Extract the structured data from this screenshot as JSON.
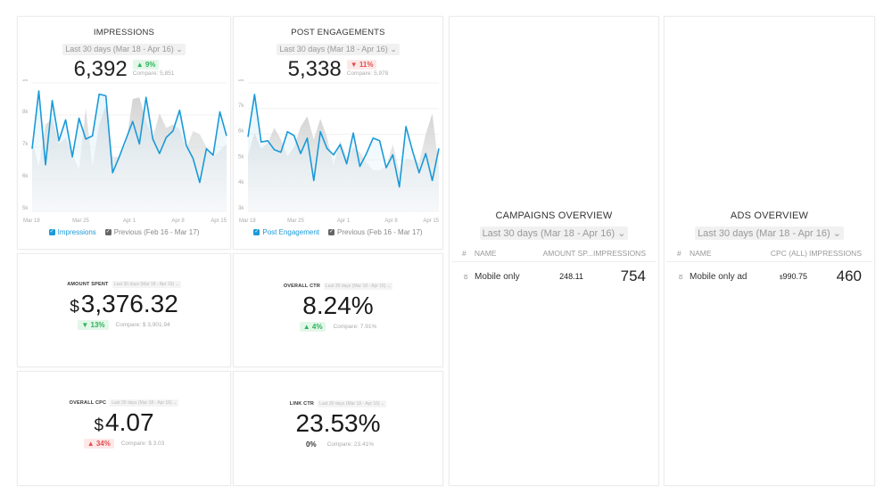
{
  "date_range": "Last 30 days (Mar 18 - Apr 16)",
  "date_range_chevron": "⌄",
  "colors": {
    "primary_line": "#1a9ad8",
    "previous_area": "#d9d9d9",
    "positive": "#2cb35a",
    "negative": "#e05050"
  },
  "impressions": {
    "title": "IMPRESSIONS",
    "value": "6,392",
    "delta": "▲ 9%",
    "compare": "Compare: 5,851",
    "legend_current": "Impressions",
    "legend_previous": "Previous (Feb 16 - Mar 17)"
  },
  "post_engagements": {
    "title": "POST ENGAGEMENTS",
    "value": "5,338",
    "delta": "▼ 11%",
    "compare": "Compare: 5,978",
    "legend_current": "Post Engagement",
    "legend_previous": "Previous (Feb 16 - Mar 17)"
  },
  "amount_spent": {
    "title": "AMOUNT SPENT",
    "range": "Last 30 days (Mar 18 - Apr 16)",
    "currency": "$",
    "value": "3,376.32",
    "delta": "▼ 13%",
    "compare": "Compare: $ 3,901.94"
  },
  "overall_ctr": {
    "title": "OVERALL CTR",
    "range": "Last 30 days (Mar 18 - Apr 16)",
    "value": "8.24%",
    "delta": "▲ 4%",
    "compare": "Compare: 7.91%"
  },
  "overall_cpc": {
    "title": "OVERALL CPC",
    "range": "Last 30 days (Mar 18 - Apr 16)",
    "currency": "$",
    "value": "4.07",
    "delta": "▲ 34%",
    "compare": "Compare: $ 3.03"
  },
  "link_ctr": {
    "title": "LINK CTR",
    "range": "Last 30 days (Mar 18 - Apr 16)",
    "value": "23.53%",
    "delta": "0%",
    "compare": "Compare: 23.41%"
  },
  "campaigns": {
    "title": "CAMPAIGNS OVERVIEW",
    "columns": [
      "#",
      "NAME",
      "AMOUNT SP...",
      "IMPRESSIONS"
    ],
    "rows": [
      {
        "icon": "medal-icon",
        "name": "Mobile only",
        "amount": "248.11",
        "impressions": "754"
      }
    ]
  },
  "ads": {
    "title": "ADS OVERVIEW",
    "columns": [
      "#",
      "NAME",
      "CPC (ALL)",
      "IMPRESSIONS"
    ],
    "rows": [
      {
        "icon": "medal-icon",
        "name": "Mobile only ad",
        "currency": "$",
        "cpc": "990.75",
        "impressions": "460"
      }
    ]
  },
  "chart_data": [
    {
      "type": "area",
      "title": "IMPRESSIONS",
      "x_tick_labels": [
        "Mar 18",
        "Mar 25",
        "Apr 1",
        "Apr 8",
        "Apr 15"
      ],
      "y_tick_labels": [
        "5k",
        "6k",
        "7k",
        "8k",
        "9k"
      ],
      "ylim": [
        5000,
        9000
      ],
      "grid": true,
      "legend": "bottom",
      "series": [
        {
          "name": "Impressions",
          "values": [
            6950,
            8750,
            6450,
            8450,
            7200,
            7850,
            6700,
            7900,
            7250,
            7350,
            8650,
            8600,
            6200,
            6700,
            7250,
            7800,
            7100,
            8550,
            7250,
            6800,
            7300,
            7500,
            8150,
            7050,
            6650,
            5900,
            6950,
            6750,
            8100,
            7350
          ]
        },
        {
          "name": "Previous (Feb 16 - Mar 17)",
          "values": [
            7200,
            6400,
            7700,
            7900,
            7100,
            7300,
            6800,
            6300,
            8200,
            6400,
            7700,
            8300,
            6700,
            6700,
            7100,
            8500,
            8550,
            7800,
            7300,
            8050,
            7600,
            7700,
            7550,
            6950,
            7500,
            7400,
            7000,
            6700,
            6900,
            7100
          ]
        }
      ]
    },
    {
      "type": "area",
      "title": "POST ENGAGEMENTS",
      "x_tick_labels": [
        "Mar 18",
        "Mar 25",
        "Apr 1",
        "Apr 8",
        "Apr 15"
      ],
      "y_tick_labels": [
        "3k",
        "4k",
        "5k",
        "6k",
        "7k",
        "8k"
      ],
      "ylim": [
        3000,
        8000
      ],
      "grid": true,
      "legend": "bottom",
      "series": [
        {
          "name": "Post Engagement",
          "values": [
            5900,
            7550,
            5700,
            5750,
            5400,
            5300,
            6100,
            5950,
            5250,
            5850,
            4200,
            6100,
            5450,
            5200,
            5600,
            4850,
            6050,
            4750,
            5250,
            5850,
            5750,
            4700,
            5200,
            3950,
            6300,
            5350,
            4500,
            5250,
            4200,
            5450
          ]
        },
        {
          "name": "Previous (Feb 16 - Mar 17)",
          "values": [
            5200,
            6050,
            5450,
            5650,
            6250,
            5800,
            5150,
            5500,
            6300,
            6700,
            5800,
            6600,
            5900,
            4800,
            5750,
            5100,
            5500,
            5300,
            4900,
            4600,
            4600,
            4750,
            5600,
            4550,
            5050,
            5000,
            4900,
            6000,
            6800,
            4700
          ]
        }
      ]
    }
  ]
}
